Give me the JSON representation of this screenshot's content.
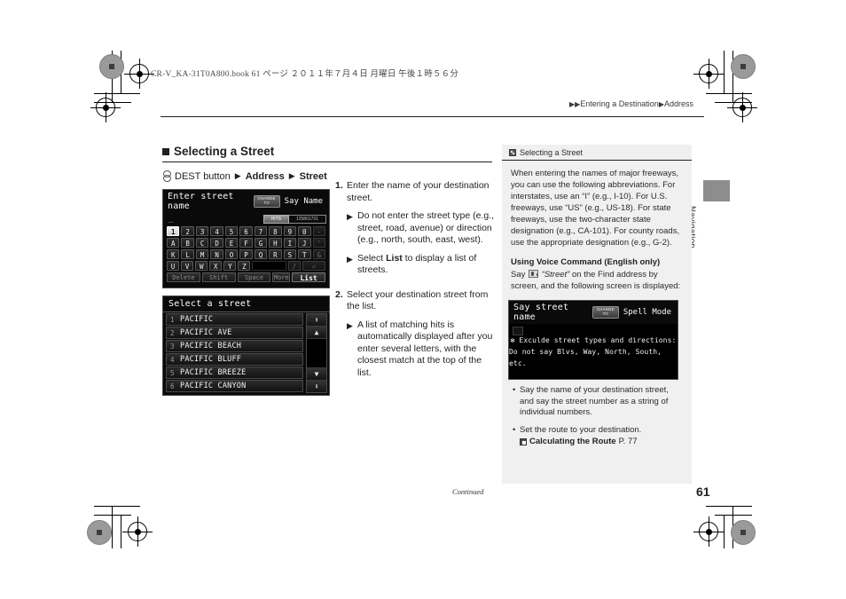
{
  "print": {
    "book_header": "CR-V_KA-31T0A800.book   61 ページ   ２０１１年７月４日   月曜日   午後１時５６分"
  },
  "breadcrumb": {
    "arrow": "▶",
    "part1": "Entering a Destination",
    "part2": "Address"
  },
  "side_tab": {
    "label": "Navigation"
  },
  "section": {
    "title": "Selecting a Street",
    "path": {
      "button": "DEST button",
      "arrow": "▶",
      "item1": "Address",
      "item2": "Street"
    }
  },
  "screen_entry": {
    "title": "Enter street name",
    "change_to": "CHANGE\nTO",
    "change_to_line1": "CHANGE",
    "change_to_line2": "TO",
    "say_name": "Say Name",
    "cursor": "_",
    "hits_label": "HITS",
    "hits_value": "125801731",
    "rows": [
      [
        "1",
        "2",
        "3",
        "4",
        "5",
        "6",
        "7",
        "8",
        "9",
        "0",
        "-"
      ],
      [
        "A",
        "B",
        "C",
        "D",
        "E",
        "F",
        "G",
        "H",
        "I",
        "J",
        "'"
      ],
      [
        "K",
        "L",
        "M",
        "N",
        "O",
        "P",
        "Q",
        "R",
        "S",
        "T",
        "&"
      ],
      [
        "U",
        "V",
        "W",
        "X",
        "Y",
        "Z",
        "",
        "",
        "/",
        "⏎"
      ]
    ],
    "function_keys": [
      "Delete",
      "Shift",
      "Space",
      "More",
      "List"
    ]
  },
  "screen_list": {
    "title": "Select a street",
    "items": [
      {
        "index": "1",
        "name": "PACIFIC"
      },
      {
        "index": "2",
        "name": "PACIFIC AVE"
      },
      {
        "index": "3",
        "name": "PACIFIC BEACH"
      },
      {
        "index": "4",
        "name": "PACIFIC BLUFF"
      },
      {
        "index": "5",
        "name": "PACIFIC BREEZE"
      },
      {
        "index": "6",
        "name": "PACIFIC CANYON"
      }
    ],
    "scroll": {
      "top": "⬆",
      "up": "▲",
      "down": "▼",
      "bottom": "⬇"
    }
  },
  "steps": [
    {
      "num": "1.",
      "text": "Enter the name of your destination street.",
      "subs": [
        {
          "arrow": "▶",
          "pre": "Do not enter the street type (e.g., street, road, avenue) or direction (e.g., north, south, east, west).",
          "bold": "",
          "post": ""
        },
        {
          "arrow": "▶",
          "pre": "Select ",
          "bold": "List",
          "post": " to display a list of streets."
        }
      ]
    },
    {
      "num": "2.",
      "text": "Select your destination street from the list.",
      "subs": [
        {
          "arrow": "▶",
          "pre": "A list of matching hits is automatically displayed after you enter several letters, with the closest match at the top of the list.",
          "bold": "",
          "post": ""
        }
      ]
    }
  ],
  "note": {
    "head": "Selecting a Street",
    "paragraph": "When entering the names of major freeways, you can use the following abbreviations. For interstates, use an “I” (e.g., I-10). For U.S. freeways, use “US” (e.g., US-18). For state freeways, use the two-character state designation (e.g., CA-101). For county roads, use the appropriate designation (e.g., G-2).",
    "voice_heading": "Using Voice Command (English only)",
    "voice_say": "Say",
    "voice_cmd": "“Street”",
    "voice_rest": "on the Find address by screen, and the following screen is displayed:",
    "screen_say": {
      "title": "Say street name",
      "change_to_line1": "CHANGE",
      "change_to_line2": "TO",
      "spell_mode": "Spell Mode",
      "line1": "✻ Exculde street types and directions:",
      "line2": "Do not say Blvs, Way, North, South, etc."
    },
    "bullets": [
      {
        "dot": "•",
        "text": "Say the name of your destination street, and say the street number as a string of individual numbers."
      },
      {
        "dot": "•",
        "text": "Set the route to your destination."
      }
    ],
    "reference": {
      "title": "Calculating the Route",
      "page": "P. 77"
    }
  },
  "footer": {
    "continued": "Continued",
    "page_number": "61"
  }
}
